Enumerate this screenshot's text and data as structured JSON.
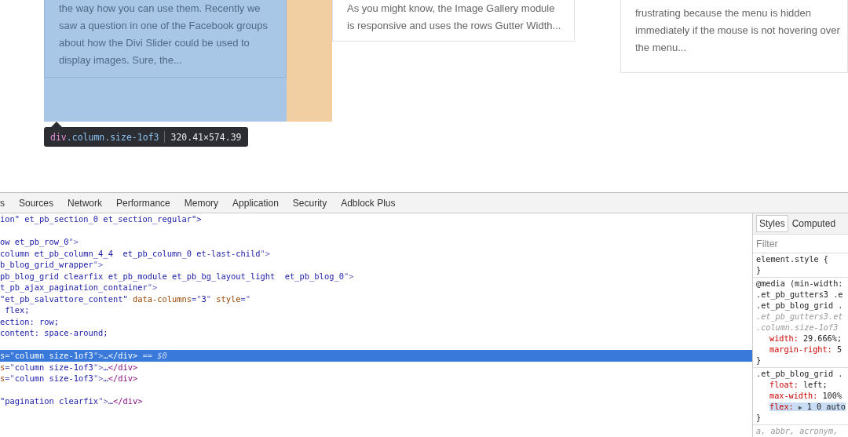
{
  "page": {
    "cards": [
      {
        "excerpt_lines": [
          "the way how you can use them. Recently we",
          "saw a question in one of the Facebook groups",
          "about how the Divi Slider could be used to",
          "display images. Sure, the..."
        ],
        "highlighted": true
      },
      {
        "excerpt_lines": [
          "As you might know, the Image Gallery module",
          "is responsive and uses the rows Gutter Width..."
        ],
        "highlighted": false
      },
      {
        "excerpt_lines": [
          "frustrating because the menu is hidden",
          "immediately if the mouse is not hovering over",
          "the menu..."
        ],
        "highlighted": false
      }
    ],
    "tooltip": {
      "tag": "div",
      "classes": ".column.size-1of3",
      "size": "320.41×574.39"
    }
  },
  "devtools": {
    "tabs": [
      {
        "label": "s",
        "selected": false
      },
      {
        "label": "Sources",
        "selected": false
      },
      {
        "label": "Network",
        "selected": false
      },
      {
        "label": "Performance",
        "selected": false
      },
      {
        "label": "Memory",
        "selected": false
      },
      {
        "label": "Application",
        "selected": false
      },
      {
        "label": "Security",
        "selected": false
      },
      {
        "label": "Adblock Plus",
        "selected": false
      }
    ],
    "dom_lines": [
      {
        "selected": false,
        "segments": [
          {
            "kind": "value",
            "text": "ion\" et_pb_section_0 et_section_regular\">"
          }
        ]
      },
      {
        "selected": false
      },
      {
        "selected": false,
        "segments": [
          {
            "kind": "value",
            "text": "ow et_pb_row_0"
          },
          {
            "kind": "punct",
            "text": "\">"
          }
        ]
      },
      {
        "selected": false,
        "segments": [
          {
            "kind": "value",
            "text": "column et_pb_column_4_4  et_pb_column_0 et-last-child"
          },
          {
            "kind": "punct",
            "text": "\">"
          }
        ]
      },
      {
        "selected": false,
        "segments": [
          {
            "kind": "value",
            "text": "b_blog_grid_wrapper"
          },
          {
            "kind": "punct",
            "text": "\">"
          }
        ]
      },
      {
        "selected": false,
        "segments": [
          {
            "kind": "value",
            "text": "pb_blog_grid clearfix et_pb_module et_pb_bg_layout_light  et_pb_blog_0"
          },
          {
            "kind": "punct",
            "text": "\">"
          }
        ]
      },
      {
        "selected": false,
        "segments": [
          {
            "kind": "value",
            "text": "t_pb_ajax_pagination_container"
          },
          {
            "kind": "punct",
            "text": "\">"
          }
        ]
      },
      {
        "selected": false,
        "segments": [
          {
            "kind": "value",
            "text": "\"et_pb_salvattore_content\" "
          },
          {
            "kind": "attr",
            "text": "data-columns"
          },
          {
            "kind": "punct",
            "text": "=\""
          },
          {
            "kind": "value",
            "text": "3"
          },
          {
            "kind": "punct",
            "text": "\" "
          },
          {
            "kind": "attr",
            "text": "style"
          },
          {
            "kind": "punct",
            "text": "=\""
          }
        ]
      },
      {
        "selected": false,
        "segments": [
          {
            "kind": "value",
            "text": " flex;"
          }
        ]
      },
      {
        "selected": false,
        "segments": [
          {
            "kind": "value",
            "text": "ection: row;"
          }
        ]
      },
      {
        "selected": false,
        "segments": [
          {
            "kind": "value",
            "text": "content: space-around;"
          }
        ]
      },
      {
        "selected": false
      },
      {
        "selected": true,
        "segments": [
          {
            "kind": "attr",
            "text": "s"
          },
          {
            "kind": "punct",
            "text": "=\""
          },
          {
            "kind": "value",
            "text": "column size-1of3"
          },
          {
            "kind": "punct",
            "text": "\">"
          },
          {
            "kind": "value",
            "text": "…"
          },
          {
            "kind": "tag",
            "text": "</div>"
          },
          {
            "kind": "dim",
            "text": " == $0"
          }
        ]
      },
      {
        "selected": false,
        "segments": [
          {
            "kind": "attr",
            "text": "s"
          },
          {
            "kind": "punct",
            "text": "=\""
          },
          {
            "kind": "value",
            "text": "column size-1of3"
          },
          {
            "kind": "punct",
            "text": "\">"
          },
          {
            "kind": "value",
            "text": "…"
          },
          {
            "kind": "tag",
            "text": "</div>"
          }
        ]
      },
      {
        "selected": false,
        "segments": [
          {
            "kind": "attr",
            "text": "s"
          },
          {
            "kind": "punct",
            "text": "=\""
          },
          {
            "kind": "value",
            "text": "column size-1of3"
          },
          {
            "kind": "punct",
            "text": "\">"
          },
          {
            "kind": "value",
            "text": "…"
          },
          {
            "kind": "tag",
            "text": "</div>"
          }
        ]
      },
      {
        "selected": false
      },
      {
        "selected": false,
        "segments": [
          {
            "kind": "value",
            "text": "\"pagination clearfix"
          },
          {
            "kind": "punct",
            "text": "\">"
          },
          {
            "kind": "value",
            "text": "…"
          },
          {
            "kind": "tag",
            "text": "</div>"
          }
        ]
      }
    ],
    "sidebar": {
      "tabs": [
        {
          "label": "Styles",
          "selected": true
        },
        {
          "label": "Computed",
          "selected": false
        }
      ],
      "filter": {
        "placeholder": "Filter"
      },
      "rules": [
        {
          "lines": [
            {
              "kind": "selector",
              "text": "element.style {"
            },
            {
              "kind": "brace",
              "text": "}"
            }
          ]
        },
        {
          "lines": [
            {
              "kind": "selector",
              "text": "@media (min-width:"
            },
            {
              "kind": "selector",
              "text": ".et_pb_gutters3 .e"
            },
            {
              "kind": "selector",
              "text": ".et_pb_blog_grid ."
            },
            {
              "kind": "dim",
              "text": ".et_pb_gutters3.et"
            },
            {
              "kind": "dim",
              "text": ".column.size-1of3"
            },
            {
              "kind": "property",
              "name": "width:",
              "value": "29.666%;"
            },
            {
              "kind": "property",
              "name": "margin-right:",
              "value": "5"
            },
            {
              "kind": "brace",
              "text": "}"
            }
          ]
        },
        {
          "lines": [
            {
              "kind": "selector",
              "text": ".et_pb_blog_grid ."
            },
            {
              "kind": "property",
              "name": "float:",
              "value": "left;"
            },
            {
              "kind": "property",
              "name": "max-width:",
              "value": "100%"
            },
            {
              "kind": "property",
              "name": "flex:",
              "toggle": "▶",
              "value": "1 0 auto",
              "highlighted": true
            },
            {
              "kind": "brace",
              "text": "}"
            }
          ]
        },
        {
          "lines": [
            {
              "kind": "dim",
              "text": "a, abbr, acronym,"
            }
          ]
        }
      ]
    }
  }
}
